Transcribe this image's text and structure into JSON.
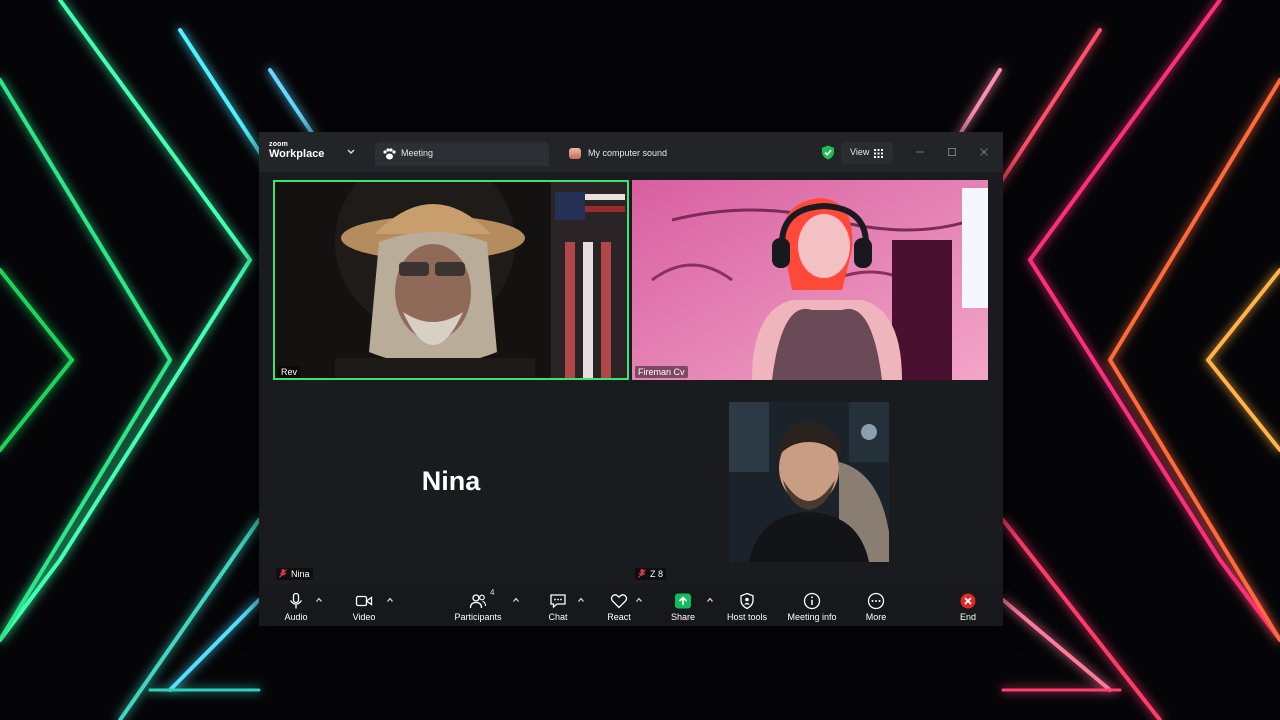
{
  "window": {
    "brand_small": "zoom",
    "brand_name": "Workplace",
    "tabs": [
      {
        "label": "Meeting",
        "icon": "paw-icon"
      },
      {
        "label": "My computer sound",
        "icon": "app-thumbnail-icon"
      }
    ],
    "view_label": "View"
  },
  "participants_tiles": [
    {
      "name": "Rev",
      "active_speaker": true
    },
    {
      "name": "Fireman Cv",
      "active_speaker": false
    },
    {
      "name": "Nina",
      "display_name": "Nina",
      "muted": true,
      "video": false
    },
    {
      "name": "Z 8",
      "muted": true
    }
  ],
  "toolbar": {
    "audio": "Audio",
    "video": "Video",
    "participants": "Participants",
    "participants_count": "4",
    "chat": "Chat",
    "react": "React",
    "share": "Share",
    "host_tools": "Host tools",
    "meeting_info": "Meeting info",
    "more": "More",
    "end": "End"
  },
  "colors": {
    "active_speaker_border": "#3be36f",
    "share_green": "#0fbd5c",
    "end_red": "#e02828",
    "shield_green": "#1dbd52"
  }
}
